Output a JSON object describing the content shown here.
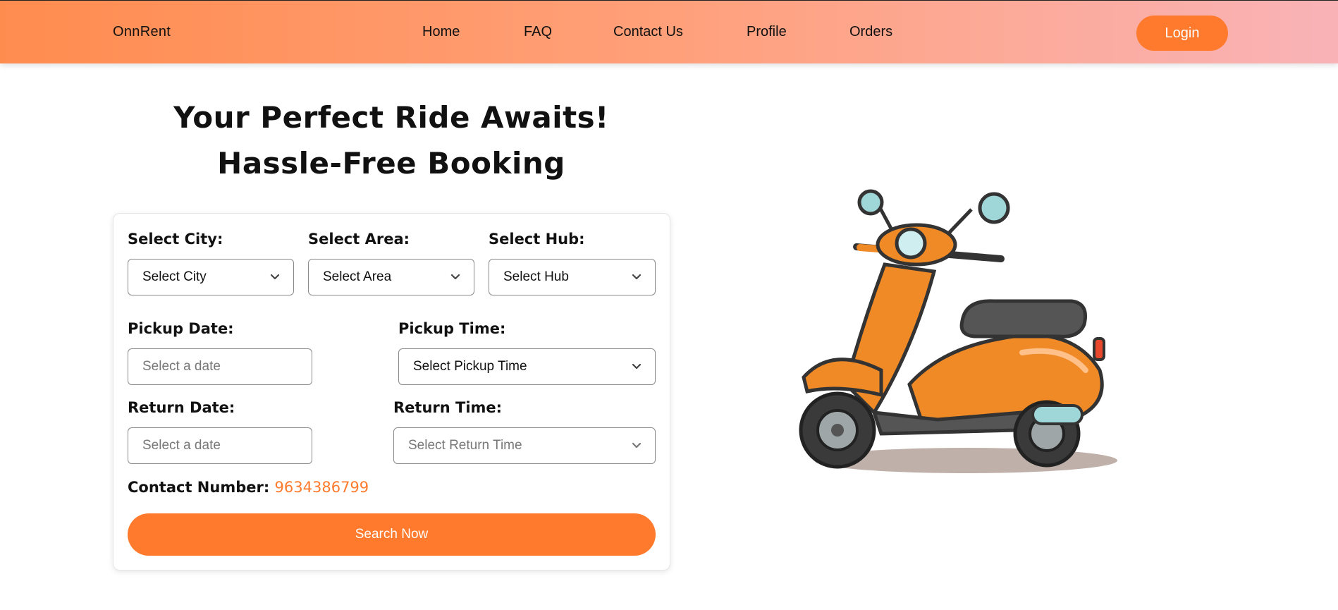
{
  "nav": {
    "brand": "OnnRent",
    "links": [
      "Home",
      "FAQ",
      "Contact Us",
      "Profile",
      "Orders"
    ],
    "login_label": "Login"
  },
  "hero": {
    "line1": "Your Perfect Ride Awaits!",
    "line2": "Hassle-Free Booking"
  },
  "form": {
    "city_label": "Select City:",
    "city_value": "Select City",
    "area_label": "Select Area:",
    "area_value": "Select Area",
    "hub_label": "Select Hub:",
    "hub_value": "Select Hub",
    "pickup_date_label": "Pickup Date:",
    "pickup_date_placeholder": "Select a date",
    "pickup_time_label": "Pickup Time:",
    "pickup_time_value": "Select Pickup Time",
    "return_date_label": "Return Date:",
    "return_date_placeholder": "Select a date",
    "return_time_label": "Return Time:",
    "return_time_value": "Select Return Time",
    "contact_label": "Contact Number:",
    "contact_number": "9634386799",
    "search_label": "Search Now"
  },
  "colors": {
    "accent": "#ff7a2c",
    "nav_gradient_start": "#ff8c4f",
    "nav_gradient_end": "#f9b3b7"
  },
  "icons": {
    "dropdown": "chevron-down-icon",
    "illustration": "scooter-illustration"
  }
}
